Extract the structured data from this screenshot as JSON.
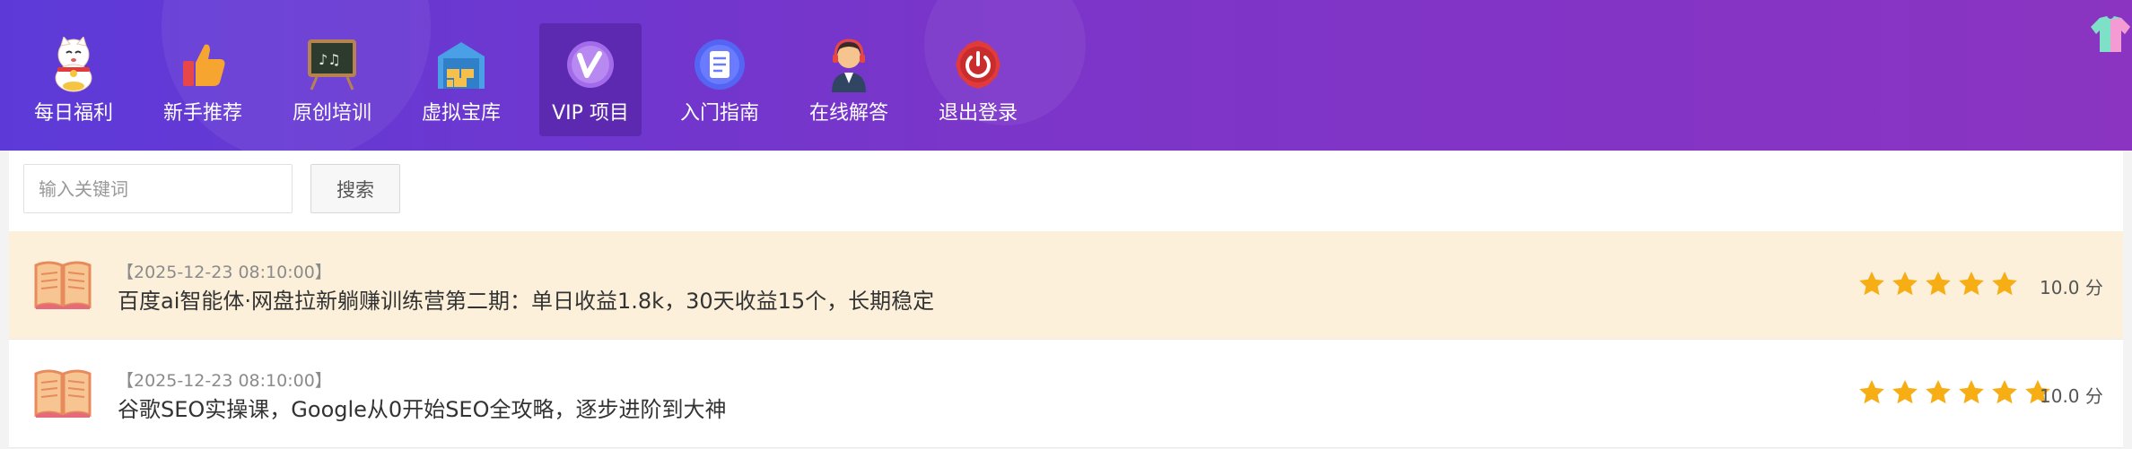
{
  "nav": {
    "items": [
      {
        "label": "每日福利",
        "icon": "lucky-cat-icon"
      },
      {
        "label": "新手推荐",
        "icon": "thumbs-up-icon"
      },
      {
        "label": "原创培训",
        "icon": "chalkboard-icon"
      },
      {
        "label": "虚拟宝库",
        "icon": "warehouse-icon"
      },
      {
        "label": "VIP 项目",
        "icon": "vip-icon",
        "active": true
      },
      {
        "label": "入门指南",
        "icon": "document-icon"
      },
      {
        "label": "在线解答",
        "icon": "support-agent-icon"
      },
      {
        "label": "退出登录",
        "icon": "power-icon"
      }
    ]
  },
  "search": {
    "placeholder": "输入关键词",
    "value": "",
    "button_label": "搜索"
  },
  "articles": [
    {
      "date": "【2025-12-23 08:10:00】",
      "title": "百度ai智能体·网盘拉新躺赚训练营第二期：单日收益1.8k，30天收益15个，长期稳定",
      "rating_stars": 5,
      "score": "10.0 分",
      "highlighted": true
    },
    {
      "date": "【2025-12-23 08:10:00】",
      "title": "谷歌SEO实操课，Google从0开始SEO全攻略，逐步进阶到大神",
      "rating_stars": 5,
      "score": "10.0 分",
      "highlighted": false
    }
  ],
  "colors": {
    "header_start": "#5d3ad8",
    "header_end": "#8b34c2",
    "star": "#f7ad14",
    "highlight_row": "#fcf0da"
  }
}
